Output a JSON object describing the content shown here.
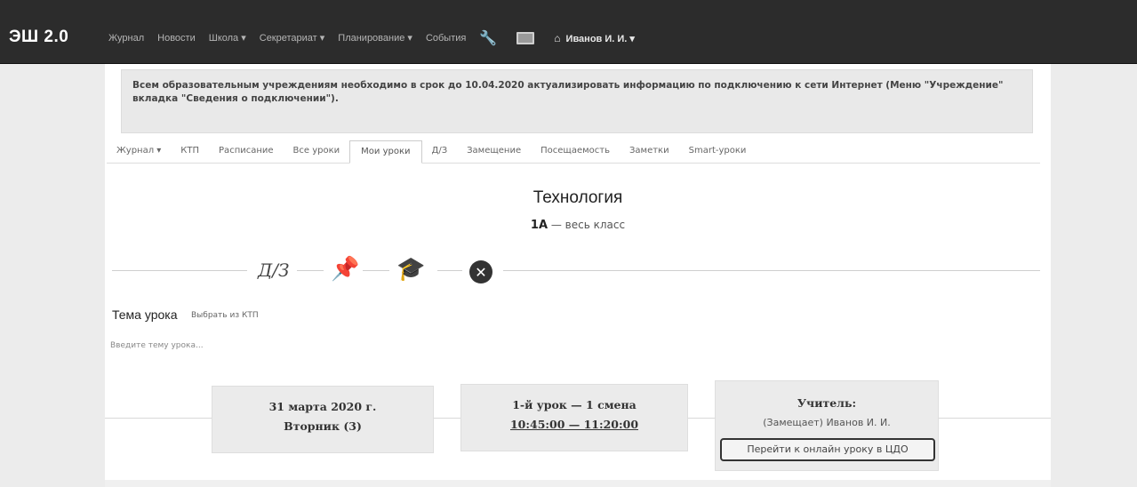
{
  "app": {
    "brand": "ЭШ 2.0"
  },
  "nav": {
    "items": [
      "Журнал",
      "Новости",
      "Школа ▾",
      "Секретариат ▾",
      "Планирование ▾",
      "События"
    ],
    "user": "Иванов И. И. ▾"
  },
  "notice": {
    "text": "Всем образовательным учреждениям необходимо в срок до 10.04.2020 актуализировать информацию по подключению к сети Интернет (Меню \"Учреждение\" вкладка \"Сведения о подключении\")."
  },
  "tabs": [
    {
      "label": "Журнал ▾"
    },
    {
      "label": "КТП"
    },
    {
      "label": "Расписание"
    },
    {
      "label": "Все уроки"
    },
    {
      "label": "Мои уроки",
      "active": true
    },
    {
      "label": "Д/З"
    },
    {
      "label": "Замещение"
    },
    {
      "label": "Посещаемость"
    },
    {
      "label": "Заметки"
    },
    {
      "label": "Smart-уроки"
    }
  ],
  "lesson": {
    "subject": "Технология",
    "class_name": "1А",
    "class_scope": " — весь класс",
    "steps": {
      "homework": "Д/З"
    }
  },
  "topic": {
    "title": "Тема урока",
    "select_link": "Выбрать из КТП",
    "placeholder": "Введите тему урока..."
  },
  "cards": {
    "date_line1": "31 марта 2020 г.",
    "date_line2": "Вторник (3)",
    "time_line1": "1-й урок — 1 смена",
    "time_line2": "10:45:00 — 11:20:00",
    "teacher_title": "Учитель:",
    "teacher_name": "(Замещает) Иванов И. И.",
    "online_button": "Перейти к онлайн уроку в ЦДО"
  }
}
